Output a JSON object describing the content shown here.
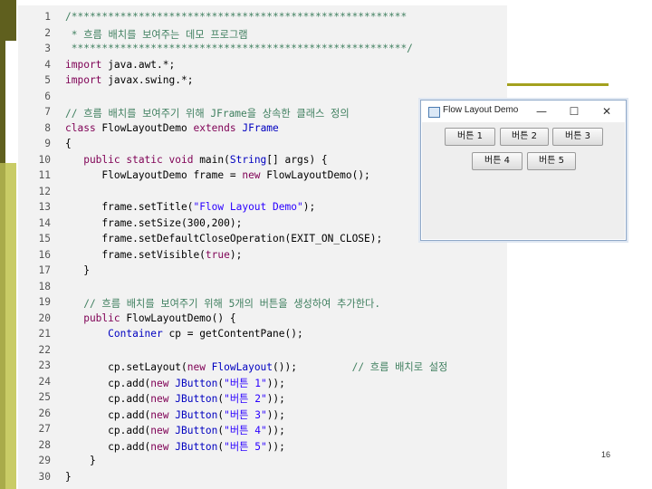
{
  "code_lines": [
    {
      "n": "1",
      "segs": [
        {
          "t": "/*******************************************************",
          "c": "cm"
        }
      ]
    },
    {
      "n": "2",
      "segs": [
        {
          "t": " * 흐름 배치를 보여주는 데모 프로그램",
          "c": "cm"
        }
      ]
    },
    {
      "n": "3",
      "segs": [
        {
          "t": " *******************************************************/",
          "c": "cm"
        }
      ]
    },
    {
      "n": "4",
      "segs": [
        {
          "t": "import ",
          "c": "kw"
        },
        {
          "t": "java.awt.*;",
          "c": ""
        }
      ]
    },
    {
      "n": "5",
      "segs": [
        {
          "t": "import ",
          "c": "kw"
        },
        {
          "t": "javax.swing.*;",
          "c": ""
        }
      ]
    },
    {
      "n": "6",
      "segs": []
    },
    {
      "n": "7",
      "segs": [
        {
          "t": "// 흐름 배치를 보여주기 위해 JFrame을 상속한 클래스 정의",
          "c": "cm"
        }
      ]
    },
    {
      "n": "8",
      "segs": [
        {
          "t": "class ",
          "c": "kw"
        },
        {
          "t": "FlowLayoutDemo ",
          "c": ""
        },
        {
          "t": "extends ",
          "c": "kw"
        },
        {
          "t": "JFrame",
          "c": "cls"
        }
      ]
    },
    {
      "n": "9",
      "segs": [
        {
          "t": "{",
          "c": ""
        }
      ]
    },
    {
      "n": "10",
      "segs": [
        {
          "t": "   public static void ",
          "c": "kw"
        },
        {
          "t": "main(",
          "c": ""
        },
        {
          "t": "String",
          "c": "cls"
        },
        {
          "t": "[] args) {",
          "c": ""
        }
      ]
    },
    {
      "n": "11",
      "segs": [
        {
          "t": "      FlowLayoutDemo frame = ",
          "c": ""
        },
        {
          "t": "new ",
          "c": "kw"
        },
        {
          "t": "FlowLayoutDemo();",
          "c": ""
        }
      ]
    },
    {
      "n": "12",
      "segs": []
    },
    {
      "n": "13",
      "segs": [
        {
          "t": "      frame.setTitle(",
          "c": ""
        },
        {
          "t": "\"Flow Layout Demo\"",
          "c": "str"
        },
        {
          "t": ");",
          "c": ""
        }
      ]
    },
    {
      "n": "14",
      "segs": [
        {
          "t": "      frame.setSize(300,200);",
          "c": ""
        }
      ]
    },
    {
      "n": "15",
      "segs": [
        {
          "t": "      frame.setDefaultCloseOperation(EXIT_ON_CLOSE);",
          "c": ""
        }
      ]
    },
    {
      "n": "16",
      "segs": [
        {
          "t": "      frame.setVisible(",
          "c": ""
        },
        {
          "t": "true",
          "c": "kw"
        },
        {
          "t": ");",
          "c": ""
        }
      ]
    },
    {
      "n": "17",
      "segs": [
        {
          "t": "   }",
          "c": ""
        }
      ]
    },
    {
      "n": "18",
      "segs": []
    },
    {
      "n": "19",
      "segs": [
        {
          "t": "   // 흐름 배치를 보여주기 위해 5개의 버튼을 생성하여 추가한다.",
          "c": "cm"
        }
      ]
    },
    {
      "n": "20",
      "segs": [
        {
          "t": "   public ",
          "c": "kw"
        },
        {
          "t": "FlowLayoutDemo() {",
          "c": ""
        }
      ]
    },
    {
      "n": "21",
      "segs": [
        {
          "t": "       Container ",
          "c": "cls"
        },
        {
          "t": "cp = getContentPane();",
          "c": ""
        }
      ]
    },
    {
      "n": "22",
      "segs": []
    },
    {
      "n": "23",
      "segs": [
        {
          "t": "       cp.setLayout(",
          "c": ""
        },
        {
          "t": "new ",
          "c": "kw"
        },
        {
          "t": "FlowLayout",
          "c": "cls"
        },
        {
          "t": "());         ",
          "c": ""
        },
        {
          "t": "// 흐름 배치로 설정",
          "c": "cm"
        }
      ]
    },
    {
      "n": "24",
      "segs": [
        {
          "t": "       cp.add(",
          "c": ""
        },
        {
          "t": "new ",
          "c": "kw"
        },
        {
          "t": "JButton",
          "c": "cls"
        },
        {
          "t": "(",
          "c": ""
        },
        {
          "t": "\"버튼 1\"",
          "c": "str"
        },
        {
          "t": "));",
          "c": ""
        }
      ]
    },
    {
      "n": "25",
      "segs": [
        {
          "t": "       cp.add(",
          "c": ""
        },
        {
          "t": "new ",
          "c": "kw"
        },
        {
          "t": "JButton",
          "c": "cls"
        },
        {
          "t": "(",
          "c": ""
        },
        {
          "t": "\"버튼 2\"",
          "c": "str"
        },
        {
          "t": "));",
          "c": ""
        }
      ]
    },
    {
      "n": "26",
      "segs": [
        {
          "t": "       cp.add(",
          "c": ""
        },
        {
          "t": "new ",
          "c": "kw"
        },
        {
          "t": "JButton",
          "c": "cls"
        },
        {
          "t": "(",
          "c": ""
        },
        {
          "t": "\"버튼 3\"",
          "c": "str"
        },
        {
          "t": "));",
          "c": ""
        }
      ]
    },
    {
      "n": "27",
      "segs": [
        {
          "t": "       cp.add(",
          "c": ""
        },
        {
          "t": "new ",
          "c": "kw"
        },
        {
          "t": "JButton",
          "c": "cls"
        },
        {
          "t": "(",
          "c": ""
        },
        {
          "t": "\"버튼 4\"",
          "c": "str"
        },
        {
          "t": "));",
          "c": ""
        }
      ]
    },
    {
      "n": "28",
      "segs": [
        {
          "t": "       cp.add(",
          "c": ""
        },
        {
          "t": "new ",
          "c": "kw"
        },
        {
          "t": "JButton",
          "c": "cls"
        },
        {
          "t": "(",
          "c": ""
        },
        {
          "t": "\"버튼 5\"",
          "c": "str"
        },
        {
          "t": "));",
          "c": ""
        }
      ]
    },
    {
      "n": "29",
      "segs": [
        {
          "t": "    }",
          "c": ""
        }
      ]
    },
    {
      "n": "30",
      "segs": [
        {
          "t": "}",
          "c": ""
        }
      ]
    }
  ],
  "window": {
    "title": "Flow Layout Demo",
    "controls": {
      "minimize": "—",
      "maximize": "☐",
      "close": "✕"
    },
    "buttons": [
      "버튼 1",
      "버튼 2",
      "버튼 3",
      "버튼 4",
      "버튼 5"
    ]
  },
  "page_number": "16",
  "colors": {
    "slide_dark": "#5f5f1e",
    "slide_light": "#c9cc66",
    "accent": "#a3a11e",
    "code_bg": "#f2f2f2",
    "keyword": "#7f0055",
    "string": "#2a00ff",
    "comment": "#3f7f5f"
  }
}
